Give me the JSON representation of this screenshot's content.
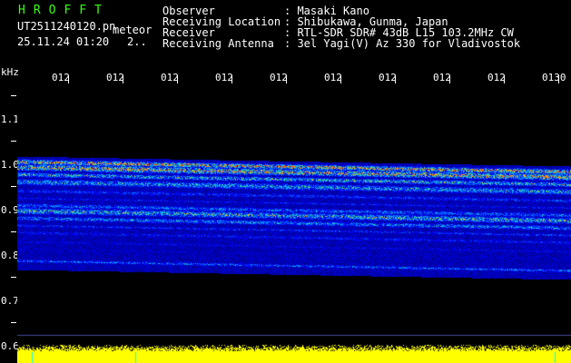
{
  "header": {
    "program": "HROFFT",
    "filename": "UT2511240120.pn",
    "mode": "meteor",
    "datetime": "25.11.24 01:20",
    "counter": "2..",
    "fields": [
      {
        "label": "Observer",
        "value": ": Masaki Kano"
      },
      {
        "label": "Receiving Location",
        "value": ": Shibukawa, Gunma, Japan"
      },
      {
        "label": "Receiver",
        "value": ": RTL-SDR SDR# 43dB L15 103.2MHz CW"
      },
      {
        "label": "Receiving Antenna",
        "value": ": 3el Yagi(V) Az 330 for Vladivostok"
      }
    ]
  },
  "axis": {
    "unit": "kHz",
    "y_labels": [
      "1.1",
      "1.0",
      "0.9",
      "0.8",
      "0.7",
      "0.6"
    ],
    "x_labels": [
      "012",
      "012",
      "012",
      "012",
      "012",
      "012",
      "012",
      "012",
      "012",
      "0130"
    ]
  },
  "colors": {
    "background": "#000000",
    "label_green": "#39ff14",
    "text": "#ffffff",
    "signal_bar": "#ffff00",
    "spectrum_dark": "#00005a"
  }
}
